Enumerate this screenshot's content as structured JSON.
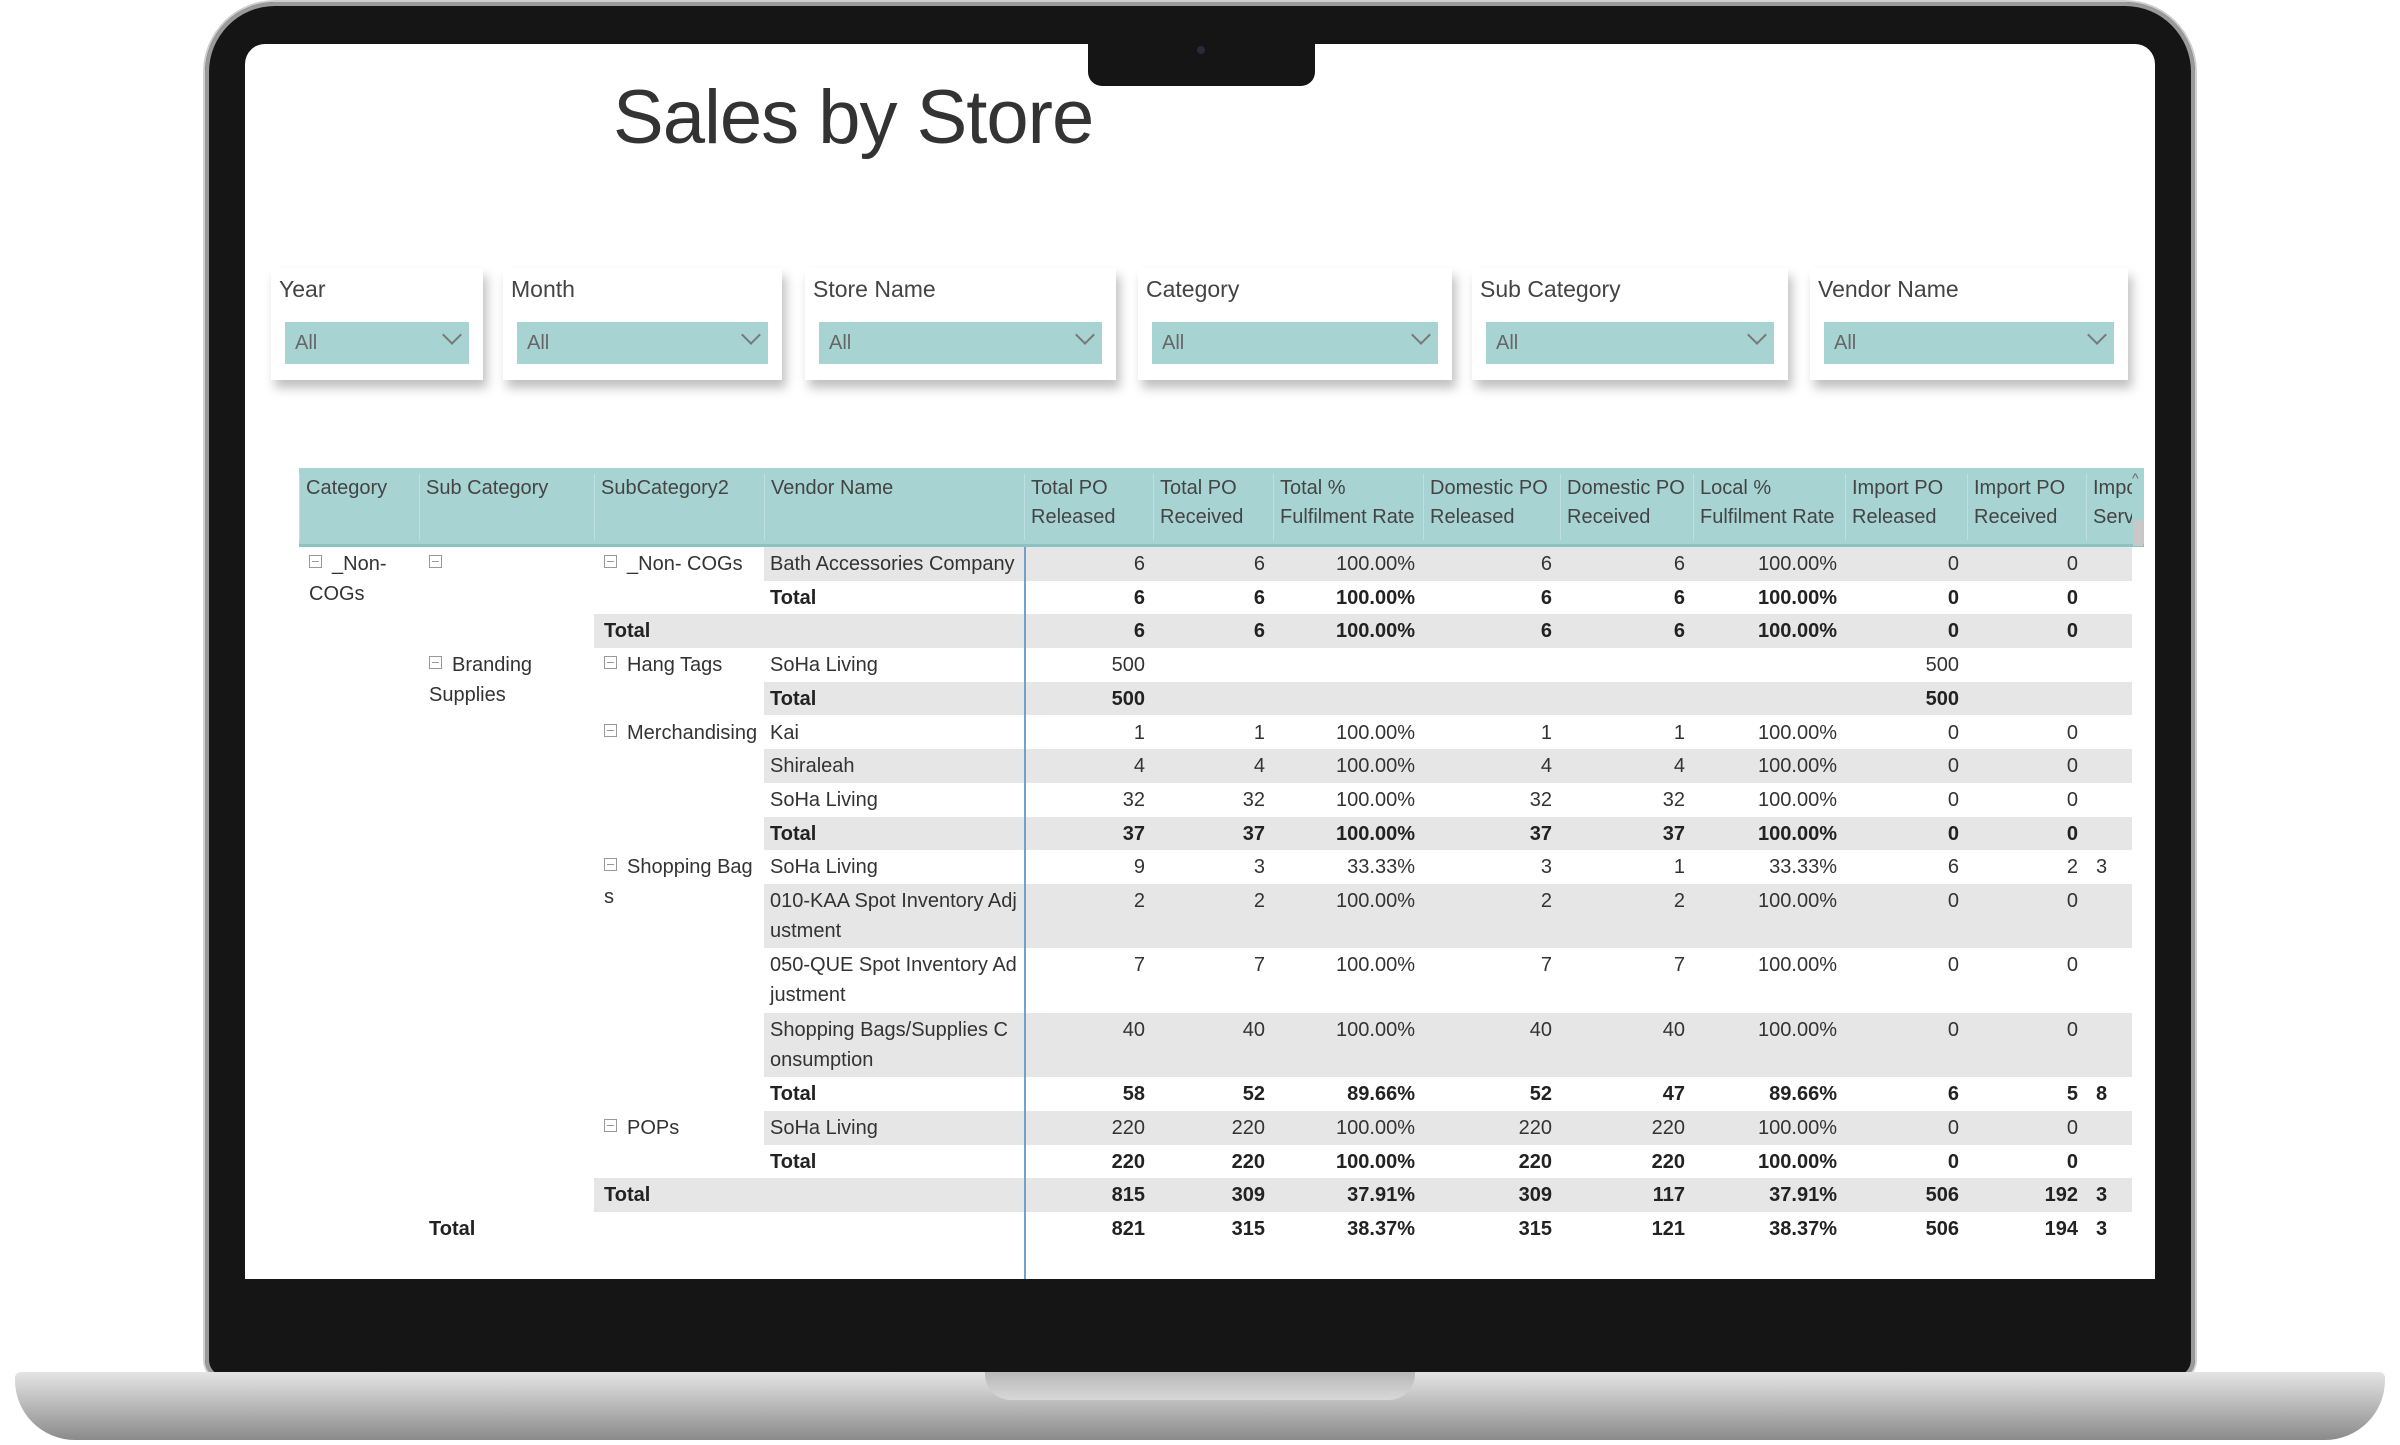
{
  "page_title": "Sales by Store",
  "slicers": [
    {
      "label": "Year",
      "value": "All"
    },
    {
      "label": "Month",
      "value": "All"
    },
    {
      "label": "Store Name",
      "value": "All"
    },
    {
      "label": "Category",
      "value": "All"
    },
    {
      "label": "Sub Category",
      "value": "All"
    },
    {
      "label": "Vendor Name",
      "value": "All"
    }
  ],
  "colors": {
    "accent": "#a8d3d3",
    "row_shade": "#e6e6e6",
    "divider": "#6fa3cf"
  },
  "table": {
    "columns": [
      "Category",
      "Sub Category",
      "SubCategory2",
      "Vendor Name",
      "Total PO\nReleased",
      "Total PO\nReceived",
      "Total %\nFulfilment Rate",
      "Domestic PO\nReleased",
      "Domestic PO\nReceived",
      "Local %\nFulfilment Rate",
      "Import PO\nReleased",
      "Import PO\nReceived",
      "Impo\nServ"
    ],
    "rows": [
      {
        "h": 1,
        "shade": 3,
        "bold": false,
        "toggles": [
          0,
          1,
          2
        ],
        "labels": [
          "_Non-COGs",
          "",
          "_Non- COGs",
          "Bath Accessories Company"
        ],
        "values": [
          "6",
          "6",
          "100.00%",
          "6",
          "6",
          "100.00%",
          "0",
          "0",
          ""
        ]
      },
      {
        "h": 1,
        "shade": null,
        "bold": true,
        "toggles": [],
        "labels": [
          "",
          "",
          "",
          "Total"
        ],
        "values": [
          "6",
          "6",
          "100.00%",
          "6",
          "6",
          "100.00%",
          "0",
          "0",
          ""
        ]
      },
      {
        "h": 1,
        "shade": 2,
        "bold": true,
        "toggles": [],
        "labels": [
          "",
          "",
          "Total",
          ""
        ],
        "values": [
          "6",
          "6",
          "100.00%",
          "6",
          "6",
          "100.00%",
          "0",
          "0",
          ""
        ]
      },
      {
        "h": 1,
        "shade": null,
        "bold": false,
        "toggles": [
          1,
          2
        ],
        "labels": [
          "",
          "Branding Supplies",
          "Hang Tags",
          "SoHa Living"
        ],
        "values": [
          "500",
          "",
          "",
          "",
          "",
          "",
          "500",
          "",
          ""
        ]
      },
      {
        "h": 1,
        "shade": 3,
        "bold": true,
        "toggles": [],
        "labels": [
          "",
          "",
          "",
          "Total"
        ],
        "values": [
          "500",
          "",
          "",
          "",
          "",
          "",
          "500",
          "",
          ""
        ]
      },
      {
        "h": 1,
        "shade": null,
        "bold": false,
        "toggles": [
          2
        ],
        "labels": [
          "",
          "",
          "Merchandising",
          "Kai"
        ],
        "values": [
          "1",
          "1",
          "100.00%",
          "1",
          "1",
          "100.00%",
          "0",
          "0",
          ""
        ]
      },
      {
        "h": 1,
        "shade": 3,
        "bold": false,
        "toggles": [],
        "labels": [
          "",
          "",
          "",
          "Shiraleah"
        ],
        "values": [
          "4",
          "4",
          "100.00%",
          "4",
          "4",
          "100.00%",
          "0",
          "0",
          ""
        ]
      },
      {
        "h": 1,
        "shade": null,
        "bold": false,
        "toggles": [],
        "labels": [
          "",
          "",
          "",
          "SoHa Living"
        ],
        "values": [
          "32",
          "32",
          "100.00%",
          "32",
          "32",
          "100.00%",
          "0",
          "0",
          ""
        ]
      },
      {
        "h": 1,
        "shade": 3,
        "bold": true,
        "toggles": [],
        "labels": [
          "",
          "",
          "",
          "Total"
        ],
        "values": [
          "37",
          "37",
          "100.00%",
          "37",
          "37",
          "100.00%",
          "0",
          "0",
          ""
        ]
      },
      {
        "h": 1,
        "shade": null,
        "bold": false,
        "toggles": [
          2
        ],
        "labels": [
          "",
          "",
          "Shopping Bags",
          "SoHa Living"
        ],
        "values": [
          "9",
          "3",
          "33.33%",
          "3",
          "1",
          "33.33%",
          "6",
          "2",
          "3"
        ]
      },
      {
        "h": 2,
        "shade": 3,
        "bold": false,
        "toggles": [],
        "labels": [
          "",
          "",
          "",
          "010-KAA Spot Inventory Adjustment"
        ],
        "values": [
          "2",
          "2",
          "100.00%",
          "2",
          "2",
          "100.00%",
          "0",
          "0",
          ""
        ]
      },
      {
        "h": 2,
        "shade": null,
        "bold": false,
        "toggles": [],
        "labels": [
          "",
          "",
          "",
          "050-QUE Spot Inventory Adjustment"
        ],
        "values": [
          "7",
          "7",
          "100.00%",
          "7",
          "7",
          "100.00%",
          "0",
          "0",
          ""
        ]
      },
      {
        "h": 2,
        "shade": 3,
        "bold": false,
        "toggles": [],
        "labels": [
          "",
          "",
          "",
          "Shopping Bags/Supplies Consumption"
        ],
        "values": [
          "40",
          "40",
          "100.00%",
          "40",
          "40",
          "100.00%",
          "0",
          "0",
          ""
        ]
      },
      {
        "h": 1,
        "shade": null,
        "bold": true,
        "toggles": [],
        "labels": [
          "",
          "",
          "",
          "Total"
        ],
        "values": [
          "58",
          "52",
          "89.66%",
          "52",
          "47",
          "89.66%",
          "6",
          "5",
          "8"
        ]
      },
      {
        "h": 1,
        "shade": 3,
        "bold": false,
        "toggles": [
          2
        ],
        "labels": [
          "",
          "",
          "POPs",
          "SoHa Living"
        ],
        "values": [
          "220",
          "220",
          "100.00%",
          "220",
          "220",
          "100.00%",
          "0",
          "0",
          ""
        ]
      },
      {
        "h": 1,
        "shade": null,
        "bold": true,
        "toggles": [],
        "labels": [
          "",
          "",
          "",
          "Total"
        ],
        "values": [
          "220",
          "220",
          "100.00%",
          "220",
          "220",
          "100.00%",
          "0",
          "0",
          ""
        ]
      },
      {
        "h": 1,
        "shade": 2,
        "bold": true,
        "toggles": [],
        "labels": [
          "",
          "",
          "Total",
          ""
        ],
        "values": [
          "815",
          "309",
          "37.91%",
          "309",
          "117",
          "37.91%",
          "506",
          "192",
          "3"
        ]
      },
      {
        "h": 1,
        "shade": null,
        "bold": true,
        "toggles": [],
        "labels": [
          "",
          "Total",
          "",
          ""
        ],
        "values": [
          "821",
          "315",
          "38.37%",
          "315",
          "121",
          "38.37%",
          "506",
          "194",
          "3"
        ]
      }
    ]
  }
}
